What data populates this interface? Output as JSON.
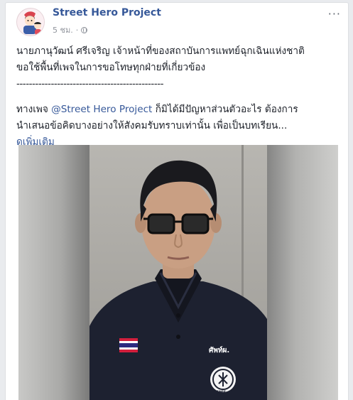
{
  "post": {
    "page_name": "Street Hero Project",
    "time": "5 ชม.",
    "separator": "·",
    "more_glyph": "···",
    "line1": "นายภานุวัฒน์ ศรีเจริญ เจ้าหน้าที่ของสถาบันการแพทย์ฉุกเฉินแห่งชาติ",
    "line2": "ขอใช้พื้นที่เพจในการขอโทษทุกฝ่ายที่เกี่ยวข้อง",
    "divider": "-----------------------------------------------",
    "line3_prefix": "ทางเพจ ",
    "mention": "@Street Hero Project",
    "line3_suffix": " ก็มิได้มีปัญหาส่วนตัวอะไร ต้องการ",
    "line4": "นำเสนอข้อคิดบางอย่างให้สังคมรับทราบเท่านั้น เพื่อเป็นบทเรียน...",
    "see_more": "ดูเพิ่มเติม"
  },
  "video": {
    "shirt_label": "ศัพท์ผ.",
    "emblem_text": "EMS"
  },
  "colors": {
    "link": "#365899",
    "text": "#1d2129",
    "meta": "#90949c",
    "shirt": "#1d2130"
  },
  "icons": {
    "globe": "globe-icon",
    "more": "more-options-icon",
    "flag": "thai-flag-icon"
  }
}
